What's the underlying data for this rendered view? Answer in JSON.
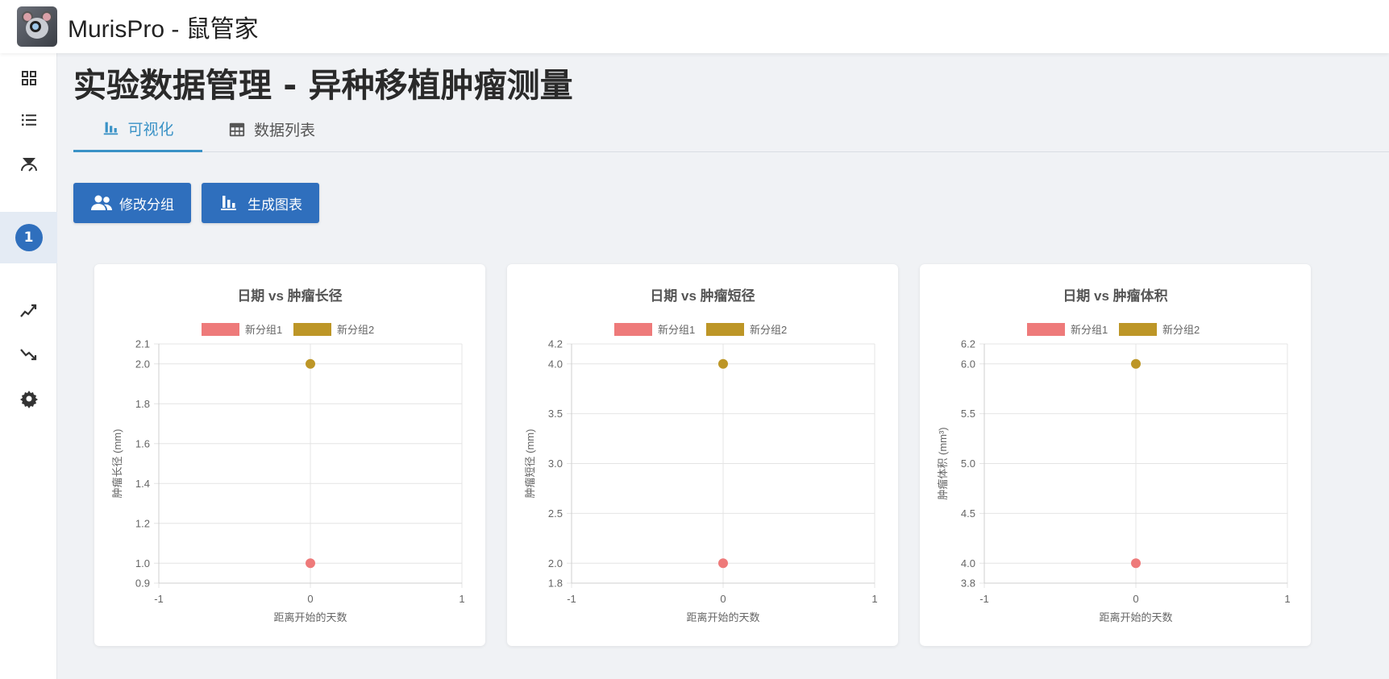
{
  "app": {
    "title": "MurisPro - 鼠管家"
  },
  "sidebar": {
    "icons": [
      "grid-icon",
      "list-icon",
      "timer-icon",
      "trend-up-icon",
      "trend-down-icon",
      "gear-icon"
    ],
    "active_badge": "1"
  },
  "page": {
    "title": "实验数据管理 - 异种移植肿瘤测量"
  },
  "tabs": [
    {
      "label": "可视化",
      "icon": "bar-chart-icon",
      "active": true
    },
    {
      "label": "数据列表",
      "icon": "table-icon",
      "active": false
    }
  ],
  "toolbar": {
    "modify_group_label": "修改分组",
    "generate_chart_label": "生成图表"
  },
  "colors": {
    "accent": "#3a92c6",
    "button": "#2f6fbd",
    "group1": "#ee7a7a",
    "group2": "#bd9627"
  },
  "chart_data": [
    {
      "type": "scatter",
      "title": "日期 vs 肿瘤长径",
      "xlabel": "距离开始的天数",
      "ylabel": "肿瘤长径 (mm)",
      "xlim": [
        -1,
        1
      ],
      "ylim": [
        0.9,
        2.1
      ],
      "xticks": [
        "-1",
        "0",
        "1"
      ],
      "yticks": [
        "0.9",
        "1.0",
        "1.2",
        "1.4",
        "1.6",
        "1.8",
        "2.0",
        "2.1"
      ],
      "series": [
        {
          "name": "新分组1",
          "points": [
            [
              0,
              1.0
            ]
          ]
        },
        {
          "name": "新分组2",
          "points": [
            [
              0,
              2.0
            ]
          ]
        }
      ],
      "legend": "top-center",
      "grid": true
    },
    {
      "type": "scatter",
      "title": "日期 vs 肿瘤短径",
      "xlabel": "距离开始的天数",
      "ylabel": "肿瘤短径 (mm)",
      "xlim": [
        -1,
        1
      ],
      "ylim": [
        1.8,
        4.2
      ],
      "xticks": [
        "-1",
        "0",
        "1"
      ],
      "yticks": [
        "1.8",
        "2.0",
        "2.5",
        "3.0",
        "3.5",
        "4.0",
        "4.2"
      ],
      "series": [
        {
          "name": "新分组1",
          "points": [
            [
              0,
              2.0
            ]
          ]
        },
        {
          "name": "新分组2",
          "points": [
            [
              0,
              4.0
            ]
          ]
        }
      ],
      "legend": "top-center",
      "grid": true
    },
    {
      "type": "scatter",
      "title": "日期 vs 肿瘤体积",
      "xlabel": "距离开始的天数",
      "ylabel": "肿瘤体积 (mm³)",
      "xlim": [
        -1,
        1
      ],
      "ylim": [
        3.8,
        6.2
      ],
      "xticks": [
        "-1",
        "0",
        "1"
      ],
      "yticks": [
        "3.8",
        "4.0",
        "4.5",
        "5.0",
        "5.5",
        "6.0",
        "6.2"
      ],
      "series": [
        {
          "name": "新分组1",
          "points": [
            [
              0,
              4.0
            ]
          ]
        },
        {
          "name": "新分组2",
          "points": [
            [
              0,
              6.0
            ]
          ]
        }
      ],
      "legend": "top-center",
      "grid": true
    }
  ]
}
